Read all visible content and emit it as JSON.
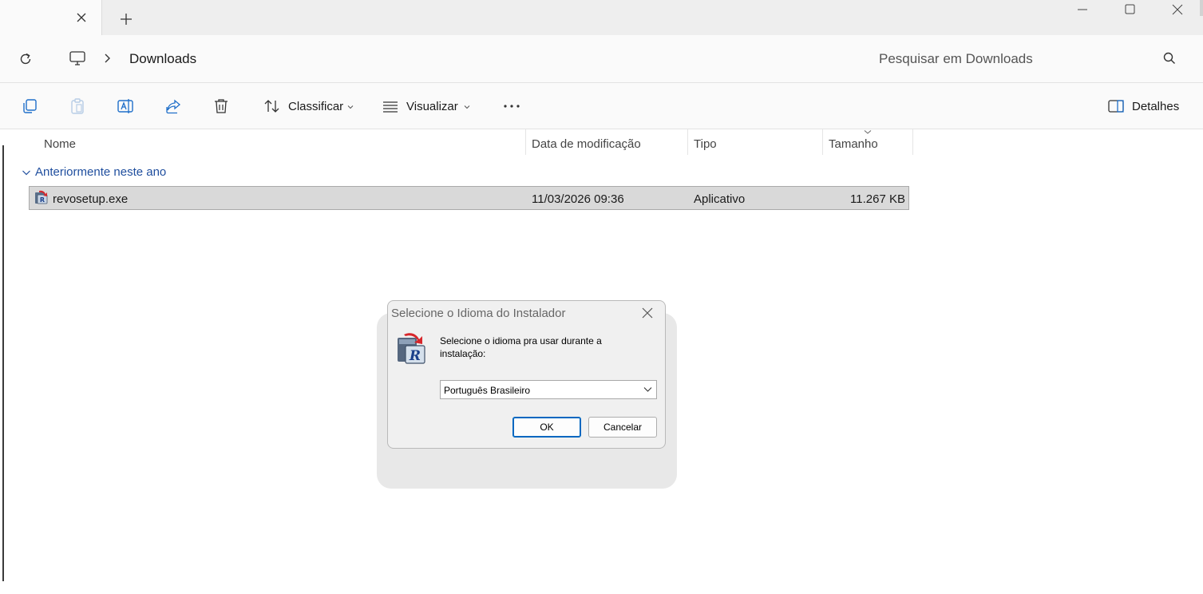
{
  "titlebar": {
    "new_tab_symbol": "+",
    "controls": [
      "minimize-icon",
      "maximize-icon",
      "close-icon"
    ]
  },
  "address": {
    "path": "Downloads",
    "search_placeholder": "Pesquisar em Downloads"
  },
  "commandbar": {
    "sort_label": "Classificar",
    "view_label": "Visualizar",
    "more_label": "···",
    "details_label": "Detalhes"
  },
  "columns": {
    "name": "Nome",
    "modified": "Data de modificação",
    "type": "Tipo",
    "size": "Tamanho"
  },
  "group": {
    "label": "Anteriormente neste ano"
  },
  "files": [
    {
      "name": "revosetup.exe",
      "modified": "11/03/2026 09:36",
      "type": "Aplicativo",
      "size": "11.267 KB"
    }
  ],
  "dialog": {
    "title": "Selecione o Idioma do Instalador",
    "message": "Selecione o idioma pra usar durante a instalação:",
    "selected_language": "Português Brasileiro",
    "ok_label": "OK",
    "cancel_label": "Cancelar"
  },
  "colors": {
    "accent": "#0067c0",
    "group_header": "#1f4e9e",
    "selected_row": "#d9d9d9"
  }
}
